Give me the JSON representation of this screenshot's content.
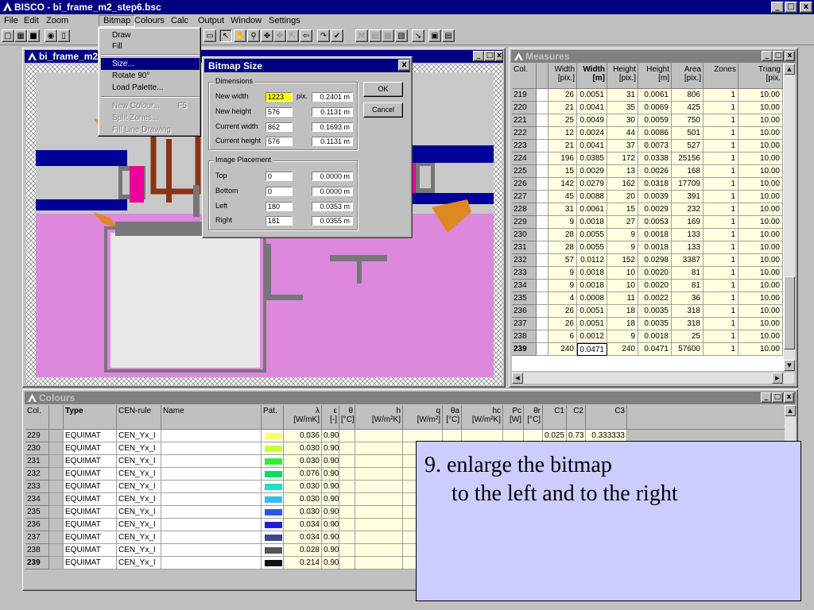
{
  "app": {
    "title": "BISCO - bi_frame_m2_step6.bsc",
    "window_buttons": [
      "_",
      "□",
      "x"
    ]
  },
  "menubar": [
    "File",
    "Edit",
    "Zoom",
    "Bitmap",
    "Colours",
    "Calc",
    "Output",
    "Window",
    "Settings"
  ],
  "bitmap_menu": {
    "items": [
      {
        "label": "Draw",
        "state": "normal"
      },
      {
        "label": "Fill",
        "state": "normal"
      },
      {
        "label": "Size...",
        "state": "highlighted"
      },
      {
        "label": "Rotate 90°",
        "state": "normal"
      },
      {
        "label": "Load Palette...",
        "state": "normal"
      },
      {
        "label": "New Colour...",
        "state": "disabled",
        "shortcut": "F5"
      },
      {
        "label": "Split Zones...",
        "state": "disabled"
      },
      {
        "label": "Fill Line Drawing",
        "state": "disabled"
      }
    ]
  },
  "bitmap_window": {
    "title": "bi_frame_m2"
  },
  "dialog": {
    "title": "Bitmap Size",
    "close": "x",
    "dimensions": {
      "label": "Dimensions",
      "new_width": {
        "label": "New width",
        "value": "1223",
        "unit": "pix.",
        "meters": "0.2401 m"
      },
      "new_height": {
        "label": "New height",
        "value": "576",
        "meters": "0.1131 m"
      },
      "current_width": {
        "label": "Current width",
        "value": "862",
        "meters": "0.1693 m"
      },
      "current_height": {
        "label": "Current height",
        "value": "576",
        "meters": "0.1131 m"
      }
    },
    "placement": {
      "label": "Image Placement",
      "top": {
        "label": "Top",
        "value": "0",
        "meters": "0.0000 m"
      },
      "bottom": {
        "label": "Bottom",
        "value": "0",
        "meters": "0.0000 m"
      },
      "left": {
        "label": "Left",
        "value": "180",
        "meters": "0.0353 m"
      },
      "right": {
        "label": "Right",
        "value": "181",
        "meters": "0.0355 m"
      }
    },
    "ok": "OK",
    "cancel": "Cancel"
  },
  "measures": {
    "title": "Measures",
    "headers": [
      {
        "l1": "Col.",
        "l2": "",
        "bold": false
      },
      {
        "l1": "Width",
        "l2": "[pix.]",
        "bold": false
      },
      {
        "l1": "Width",
        "l2": "[m]",
        "bold": true
      },
      {
        "l1": "Height",
        "l2": "[pix.]",
        "bold": false
      },
      {
        "l1": "Height",
        "l2": "[m]",
        "bold": false
      },
      {
        "l1": "Area",
        "l2": "[pix.]",
        "bold": false
      },
      {
        "l1": "Zones",
        "l2": "",
        "bold": false
      },
      {
        "l1": "Triang",
        "l2": "[pix.",
        "bold": false
      }
    ],
    "rows": [
      [
        "219",
        "26",
        "0.0051",
        "31",
        "0.0061",
        "806",
        "1",
        "10.00"
      ],
      [
        "220",
        "21",
        "0.0041",
        "35",
        "0.0069",
        "425",
        "1",
        "10.00"
      ],
      [
        "221",
        "25",
        "0.0049",
        "30",
        "0.0059",
        "750",
        "1",
        "10.00"
      ],
      [
        "222",
        "12",
        "0.0024",
        "44",
        "0.0086",
        "501",
        "1",
        "10.00"
      ],
      [
        "223",
        "21",
        "0.0041",
        "37",
        "0.0073",
        "527",
        "1",
        "10.00"
      ],
      [
        "224",
        "196",
        "0.0385",
        "172",
        "0.0338",
        "25156",
        "1",
        "10.00"
      ],
      [
        "225",
        "15",
        "0.0029",
        "13",
        "0.0026",
        "168",
        "1",
        "10.00"
      ],
      [
        "226",
        "142",
        "0.0279",
        "162",
        "0.0318",
        "17709",
        "1",
        "10.00"
      ],
      [
        "227",
        "45",
        "0.0088",
        "20",
        "0.0039",
        "391",
        "1",
        "10.00"
      ],
      [
        "228",
        "31",
        "0.0061",
        "15",
        "0.0029",
        "232",
        "1",
        "10.00"
      ],
      [
        "229",
        "9",
        "0.0018",
        "27",
        "0.0053",
        "169",
        "1",
        "10.00"
      ],
      [
        "230",
        "28",
        "0.0055",
        "9",
        "0.0018",
        "133",
        "1",
        "10.00"
      ],
      [
        "231",
        "28",
        "0.0055",
        "9",
        "0.0018",
        "133",
        "1",
        "10.00"
      ],
      [
        "232",
        "57",
        "0.0112",
        "152",
        "0.0298",
        "3387",
        "1",
        "10.00"
      ],
      [
        "233",
        "9",
        "0.0018",
        "10",
        "0.0020",
        "81",
        "1",
        "10.00"
      ],
      [
        "234",
        "9",
        "0.0018",
        "10",
        "0.0020",
        "81",
        "1",
        "10.00"
      ],
      [
        "235",
        "4",
        "0.0008",
        "11",
        "0.0022",
        "36",
        "1",
        "10.00"
      ],
      [
        "236",
        "26",
        "0.0051",
        "18",
        "0.0035",
        "318",
        "1",
        "10.00"
      ],
      [
        "237",
        "26",
        "0.0051",
        "18",
        "0.0035",
        "318",
        "1",
        "10.00"
      ],
      [
        "238",
        "6",
        "0.0012",
        "9",
        "0.0018",
        "25",
        "1",
        "10.00"
      ],
      [
        "239",
        "240",
        "0.0471",
        "240",
        "0.0471",
        "57600",
        "1",
        "10.00"
      ]
    ]
  },
  "colours": {
    "title": "Colours",
    "headers": [
      {
        "l1": "Col.",
        "l2": ""
      },
      {
        "l1": "",
        "l2": ""
      },
      {
        "l1": "Type",
        "l2": ""
      },
      {
        "l1": "CEN-rule",
        "l2": ""
      },
      {
        "l1": "Name",
        "l2": ""
      },
      {
        "l1": "Pat.",
        "l2": ""
      },
      {
        "l1": "λ",
        "l2": "[W/mK]"
      },
      {
        "l1": "ε",
        "l2": "[-]"
      },
      {
        "l1": "θ",
        "l2": "[°C]"
      },
      {
        "l1": "h",
        "l2": "[W/m²K]"
      },
      {
        "l1": "q",
        "l2": "[W/m²]"
      },
      {
        "l1": "θa",
        "l2": "[°C]"
      },
      {
        "l1": "hc",
        "l2": "[W/m²K]"
      },
      {
        "l1": "Pc",
        "l2": "[W]"
      },
      {
        "l1": "θr",
        "l2": "[°C]"
      },
      {
        "l1": "C1",
        "l2": ""
      },
      {
        "l1": "C2",
        "l2": ""
      },
      {
        "l1": "C3",
        "l2": ""
      }
    ],
    "rows": [
      {
        "col": "229",
        "type": "EQUIMAT",
        "rule": "CEN_Yx_I",
        "pat": "#ffff66",
        "lambda": "0.036",
        "eps": "0.90",
        "c1": "0.025",
        "c2": "0.73",
        "c3": "0.333333"
      },
      {
        "col": "230",
        "type": "EQUIMAT",
        "rule": "CEN_Yx_I",
        "pat": "#ccff33",
        "lambda": "0.030",
        "eps": "0.90"
      },
      {
        "col": "231",
        "type": "EQUIMAT",
        "rule": "CEN_Yx_I",
        "pat": "#33ee33",
        "lambda": "0.030",
        "eps": "0.90"
      },
      {
        "col": "232",
        "type": "EQUIMAT",
        "rule": "CEN_Yx_I",
        "pat": "#00dd66",
        "lambda": "0.076",
        "eps": "0.90"
      },
      {
        "col": "233",
        "type": "EQUIMAT",
        "rule": "CEN_Yx_I",
        "pat": "#22ddcc",
        "lambda": "0.030",
        "eps": "0.90"
      },
      {
        "col": "234",
        "type": "EQUIMAT",
        "rule": "CEN_Yx_I",
        "pat": "#33bbee",
        "lambda": "0.030",
        "eps": "0.90"
      },
      {
        "col": "235",
        "type": "EQUIMAT",
        "rule": "CEN_Yx_I",
        "pat": "#3355dd",
        "lambda": "0.030",
        "eps": "0.90"
      },
      {
        "col": "236",
        "type": "EQUIMAT",
        "rule": "CEN_Yx_I",
        "pat": "#2222cc",
        "lambda": "0.034",
        "eps": "0.90"
      },
      {
        "col": "237",
        "type": "EQUIMAT",
        "rule": "CEN_Yx_I",
        "pat": "#444488",
        "lambda": "0.034",
        "eps": "0.90"
      },
      {
        "col": "238",
        "type": "EQUIMAT",
        "rule": "CEN_Yx_I",
        "pat": "#555555",
        "lambda": "0.028",
        "eps": "0.90"
      },
      {
        "col": "239",
        "type": "EQUIMAT",
        "rule": "CEN_Yx_I",
        "pat": "#111111",
        "lambda": "0.214",
        "eps": "0.90"
      }
    ]
  },
  "callout": {
    "line1": "9. enlarge the bitmap",
    "line2": "to the left and to the right"
  },
  "palette": {
    "title_active": "#000080",
    "selection": "#ffff00",
    "frame_pink": "#dd88dd",
    "frame_blue": "#000099",
    "frame_gray": "#777777",
    "frame_light": "#bbbbbb",
    "frame_brown": "#883311",
    "frame_orange": "#dd8822",
    "frame_magenta": "#ee0099",
    "callout_bg": "#ccccff"
  }
}
